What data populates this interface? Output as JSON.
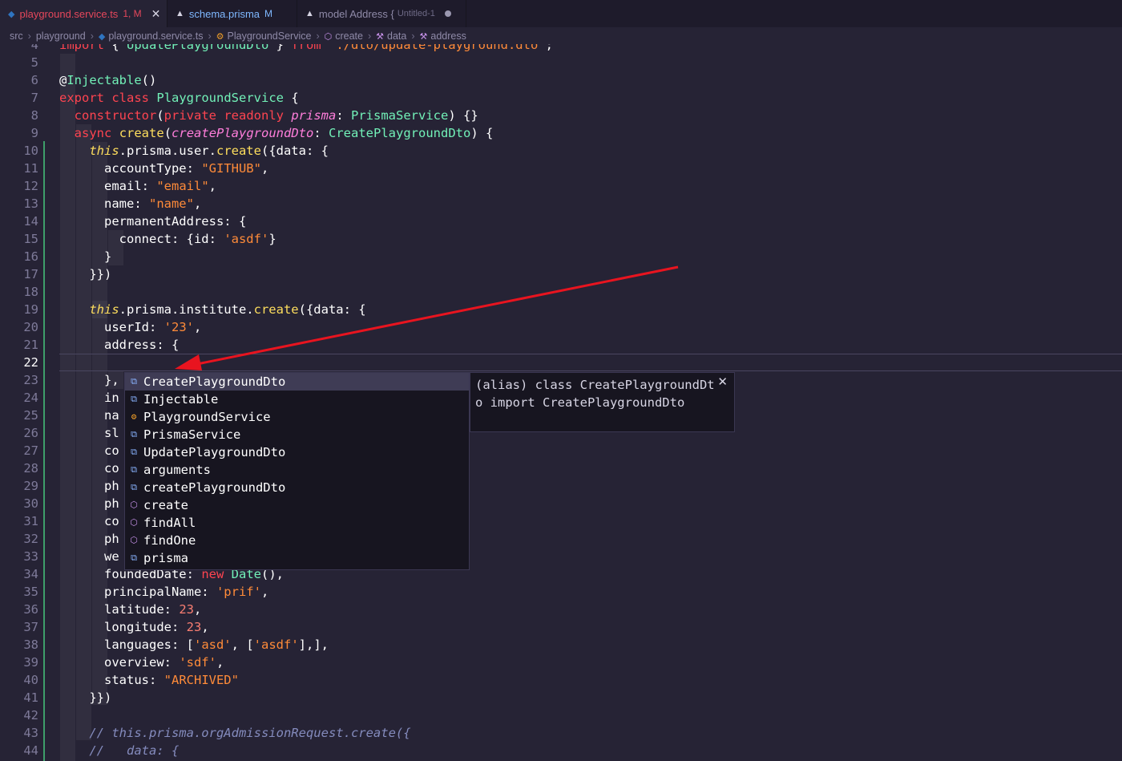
{
  "tabs": [
    {
      "icon": "prisma-ts-file-icon",
      "name": "playground.service.ts",
      "modified": "1, M",
      "suffix": "",
      "active": true,
      "color": "#e5475b"
    },
    {
      "icon": "prisma-file-icon",
      "name": "schema.prisma",
      "modified": "M",
      "suffix": "",
      "active": false,
      "color": "#7fb8ff"
    },
    {
      "icon": "prisma-file-icon",
      "name": "model Address {",
      "modified": "",
      "suffix": "Untitled-1",
      "active": false,
      "color": "#8f8aa8"
    }
  ],
  "breadcrumb": [
    "src",
    "playground",
    "playground.service.ts",
    "PlaygroundService",
    "create",
    "data",
    "address"
  ],
  "editor": {
    "current_line": 22,
    "lines": [
      {
        "n": 4,
        "text": "import { UpdatePlaygroundDto } from './dto/update-playground.dto';"
      },
      {
        "n": 5,
        "text": ""
      },
      {
        "n": 6,
        "text": "@Injectable()"
      },
      {
        "n": 7,
        "text": "export class PlaygroundService {"
      },
      {
        "n": 8,
        "text": "  constructor(private readonly prisma: PrismaService) {}"
      },
      {
        "n": 9,
        "text": "  async create(createPlaygroundDto: CreatePlaygroundDto) {"
      },
      {
        "n": 10,
        "text": "    this.prisma.user.create({data: {"
      },
      {
        "n": 11,
        "text": "      accountType: \"GITHUB\","
      },
      {
        "n": 12,
        "text": "      email: \"email\","
      },
      {
        "n": 13,
        "text": "      name: \"name\","
      },
      {
        "n": 14,
        "text": "      permanentAddress: {"
      },
      {
        "n": 15,
        "text": "        connect: {id: 'asdf'}"
      },
      {
        "n": 16,
        "text": "      }"
      },
      {
        "n": 17,
        "text": "    }})"
      },
      {
        "n": 18,
        "text": ""
      },
      {
        "n": 19,
        "text": "    this.prisma.institute.create({data: {"
      },
      {
        "n": 20,
        "text": "      userId: '23',"
      },
      {
        "n": 21,
        "text": "      address: {"
      },
      {
        "n": 22,
        "text": ""
      },
      {
        "n": 23,
        "text": "      },"
      },
      {
        "n": 24,
        "text": "      in"
      },
      {
        "n": 25,
        "text": "      na"
      },
      {
        "n": 26,
        "text": "      sl"
      },
      {
        "n": 27,
        "text": "      co"
      },
      {
        "n": 28,
        "text": "      co"
      },
      {
        "n": 29,
        "text": "      ph"
      },
      {
        "n": 30,
        "text": "      ph"
      },
      {
        "n": 31,
        "text": "      co"
      },
      {
        "n": 32,
        "text": "      ph"
      },
      {
        "n": 33,
        "text": "      we"
      },
      {
        "n": 34,
        "text": "      foundedDate: new Date(),"
      },
      {
        "n": 35,
        "text": "      principalName: 'prif',"
      },
      {
        "n": 36,
        "text": "      latitude: 23,"
      },
      {
        "n": 37,
        "text": "      longitude: 23,"
      },
      {
        "n": 38,
        "text": "      languages: ['asd', ['asdf'],],"
      },
      {
        "n": 39,
        "text": "      overview: 'sdf',"
      },
      {
        "n": 40,
        "text": "      status: \"ARCHIVED\""
      },
      {
        "n": 41,
        "text": "    }})"
      },
      {
        "n": 42,
        "text": ""
      },
      {
        "n": 43,
        "text": "    // this.prisma.orgAdmissionRequest.create({"
      },
      {
        "n": 44,
        "text": "    //   data: {"
      }
    ]
  },
  "suggestions": [
    {
      "kind": "variable-icon",
      "label": "CreatePlaygroundDto",
      "selected": true
    },
    {
      "kind": "variable-icon",
      "label": "Injectable",
      "selected": false
    },
    {
      "kind": "class-icon",
      "label": "PlaygroundService",
      "selected": false
    },
    {
      "kind": "variable-icon",
      "label": "PrismaService",
      "selected": false
    },
    {
      "kind": "variable-icon",
      "label": "UpdatePlaygroundDto",
      "selected": false
    },
    {
      "kind": "variable-icon",
      "label": "arguments",
      "selected": false
    },
    {
      "kind": "variable-icon",
      "label": "createPlaygroundDto",
      "selected": false
    },
    {
      "kind": "method-icon",
      "label": "create",
      "selected": false
    },
    {
      "kind": "method-icon",
      "label": "findAll",
      "selected": false
    },
    {
      "kind": "method-icon",
      "label": "findOne",
      "selected": false
    },
    {
      "kind": "variable-icon",
      "label": "prisma",
      "selected": false
    }
  ],
  "docs": {
    "text": "(alias) class CreatePlaygroundDto import CreatePlaygroundDto",
    "close_icon": "close-icon"
  },
  "annotation": {
    "color": "#e8141f",
    "icon": "arrow-icon"
  }
}
